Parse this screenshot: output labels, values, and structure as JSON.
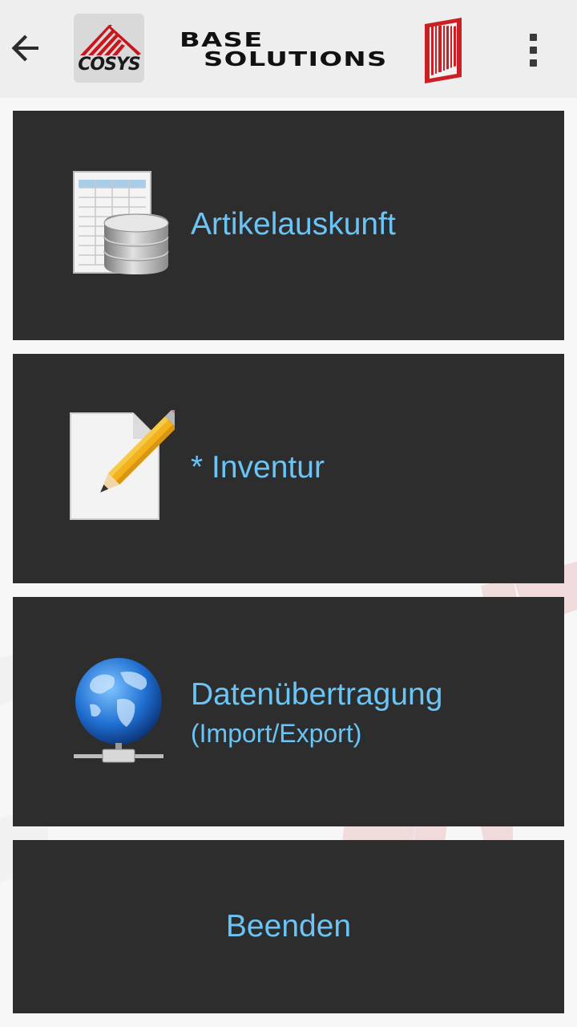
{
  "toolbar": {
    "brand_line1": "BASE",
    "brand_line2": "SOLUTIONS",
    "logo_text": "COSYS",
    "icons": {
      "back": "arrow-left-icon",
      "barcode": "barcode-icon",
      "overflow": "more-vert-icon"
    }
  },
  "menu": [
    {
      "label": "Artikelauskunft",
      "icon": "database-table-icon"
    },
    {
      "label": "* Inventur",
      "icon": "document-pencil-icon"
    },
    {
      "label": "Datenübertragung",
      "sublabel": "(Import/Export)",
      "icon": "network-globe-icon"
    },
    {
      "label": "Beenden"
    }
  ],
  "colors": {
    "tile_background": "#2d2d2d",
    "label_text": "#6ac4f5",
    "toolbar_background": "#eeeeee",
    "brand_red": "#cc1f24"
  }
}
